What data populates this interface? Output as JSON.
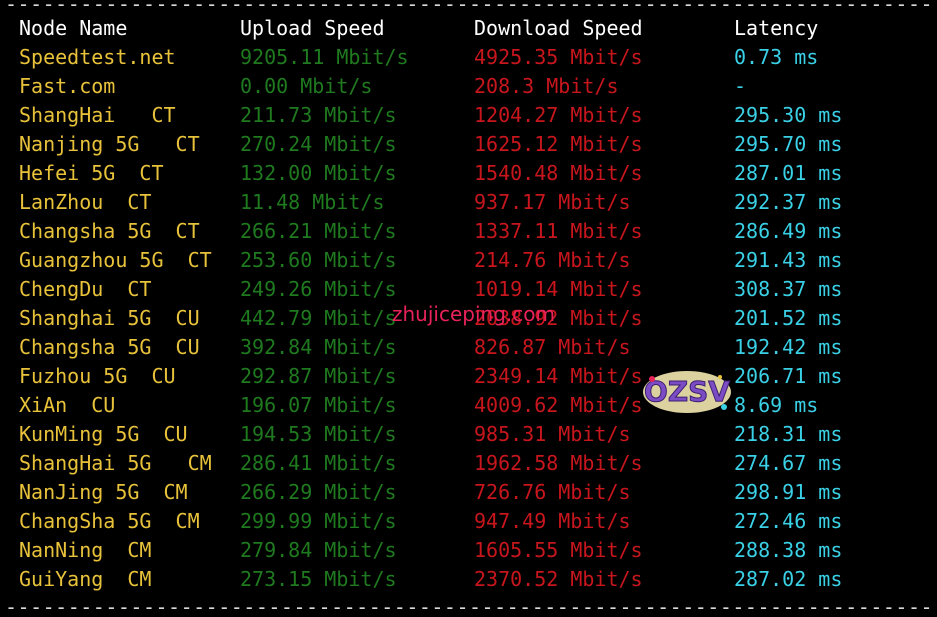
{
  "rule": "--------------------------------------------------------------------------------------------------------",
  "headers": {
    "node": "Node Name",
    "upload": "Upload Speed",
    "download": "Download Speed",
    "latency": "Latency"
  },
  "rows": [
    {
      "node": "Speedtest.net",
      "upload": "9205.11 Mbit/s",
      "download": "4925.35 Mbit/s",
      "latency": "0.73 ms"
    },
    {
      "node": "Fast.com",
      "upload": "0.00 Mbit/s",
      "download": "208.3 Mbit/s",
      "latency": "-"
    },
    {
      "node": "ShangHai   CT",
      "upload": "211.73 Mbit/s",
      "download": "1204.27 Mbit/s",
      "latency": "295.30 ms"
    },
    {
      "node": "Nanjing 5G   CT",
      "upload": "270.24 Mbit/s",
      "download": "1625.12 Mbit/s",
      "latency": "295.70 ms"
    },
    {
      "node": "Hefei 5G  CT",
      "upload": "132.00 Mbit/s",
      "download": "1540.48 Mbit/s",
      "latency": "287.01 ms"
    },
    {
      "node": "LanZhou  CT",
      "upload": "11.48 Mbit/s",
      "download": "937.17 Mbit/s",
      "latency": "292.37 ms"
    },
    {
      "node": "Changsha 5G  CT",
      "upload": "266.21 Mbit/s",
      "download": "1337.11 Mbit/s",
      "latency": "286.49 ms"
    },
    {
      "node": "Guangzhou 5G  CT",
      "upload": "253.60 Mbit/s",
      "download": "214.76 Mbit/s",
      "latency": "291.43 ms"
    },
    {
      "node": "ChengDu  CT",
      "upload": "249.26 Mbit/s",
      "download": "1019.14 Mbit/s",
      "latency": "308.37 ms"
    },
    {
      "node": "Shanghai 5G  CU",
      "upload": "442.79 Mbit/s",
      "download": "2038.92 Mbit/s",
      "latency": "201.52 ms"
    },
    {
      "node": "Changsha 5G  CU",
      "upload": "392.84 Mbit/s",
      "download": "826.87 Mbit/s",
      "latency": "192.42 ms"
    },
    {
      "node": "Fuzhou 5G  CU",
      "upload": "292.87 Mbit/s",
      "download": "2349.14 Mbit/s",
      "latency": "206.71 ms"
    },
    {
      "node": "XiAn  CU",
      "upload": "196.07 Mbit/s",
      "download": "4009.62 Mbit/s",
      "latency": "8.69 ms"
    },
    {
      "node": "KunMing 5G  CU",
      "upload": "194.53 Mbit/s",
      "download": "985.31 Mbit/s",
      "latency": "218.31 ms"
    },
    {
      "node": "ShangHai 5G   CM",
      "upload": "286.41 Mbit/s",
      "download": "1962.58 Mbit/s",
      "latency": "274.67 ms"
    },
    {
      "node": "NanJing 5G  CM",
      "upload": "266.29 Mbit/s",
      "download": "726.76 Mbit/s",
      "latency": "298.91 ms"
    },
    {
      "node": "ChangSha 5G  CM",
      "upload": "299.99 Mbit/s",
      "download": "947.49 Mbit/s",
      "latency": "272.46 ms"
    },
    {
      "node": "NanNing  CM",
      "upload": "279.84 Mbit/s",
      "download": "1605.55 Mbit/s",
      "latency": "288.38 ms"
    },
    {
      "node": "GuiYang  CM",
      "upload": "273.15 Mbit/s",
      "download": "2370.52 Mbit/s",
      "latency": "287.02 ms"
    }
  ],
  "watermark": "zhujiceping.com",
  "logo": "OZSV",
  "colors": {
    "background": "#000000",
    "header": "#ffffff",
    "node": "#e8c23a",
    "upload": "#1f7a1f",
    "download": "#c8161d",
    "latency": "#3ad1e6",
    "watermark": "#e8235a"
  }
}
